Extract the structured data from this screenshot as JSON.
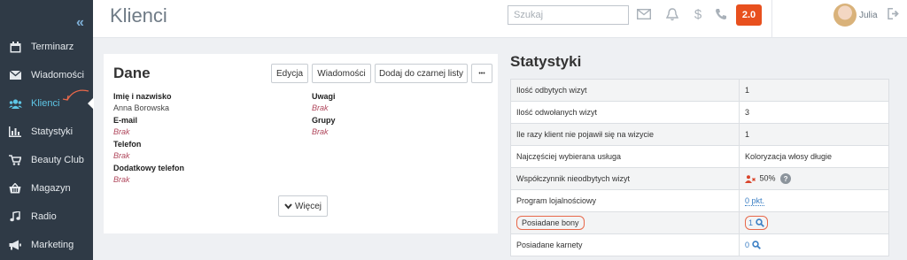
{
  "header": {
    "title": "Klienci",
    "search_placeholder": "Szukaj",
    "version": "2.0",
    "user_name": "Julia"
  },
  "sidebar": {
    "items": [
      {
        "label": "Terminarz",
        "icon": "calendar-icon"
      },
      {
        "label": "Wiadomości",
        "icon": "envelope-icon"
      },
      {
        "label": "Klienci",
        "icon": "users-icon",
        "active": true
      },
      {
        "label": "Statystyki",
        "icon": "bar-chart-icon"
      },
      {
        "label": "Beauty Club",
        "icon": "cart-icon"
      },
      {
        "label": "Magazyn",
        "icon": "basket-icon"
      },
      {
        "label": "Radio",
        "icon": "music-icon"
      },
      {
        "label": "Marketing",
        "icon": "megaphone-icon"
      }
    ]
  },
  "dane": {
    "title": "Dane",
    "buttons": {
      "edit": "Edycja",
      "messages": "Wiadomości",
      "blacklist": "Dodaj do czarnej listy",
      "more_dots": "•••"
    },
    "fields": {
      "name_label": "Imię i nazwisko",
      "name_value": "Anna Borowska",
      "email_label": "E-mail",
      "email_value": "Brak",
      "phone_label": "Telefon",
      "phone_value": "Brak",
      "extra_phone_label": "Dodatkowy telefon",
      "extra_phone_value": "Brak",
      "notes_label": "Uwagi",
      "notes_value": "Brak",
      "groups_label": "Grupy",
      "groups_value": "Brak"
    },
    "more_button": "Więcej"
  },
  "stats": {
    "title": "Statystyki",
    "rows": [
      {
        "label": "Ilość odbytych wizyt",
        "value": "1"
      },
      {
        "label": "Ilość odwołanych wizyt",
        "value": "3"
      },
      {
        "label": "Ile razy klient nie pojawił się na wizycie",
        "value": "1"
      },
      {
        "label": "Najczęściej wybierana usługa",
        "value": "Koloryzacja włosy długie"
      },
      {
        "label": "Współczynnik nieodbytych wizyt",
        "value": "50%"
      },
      {
        "label": "Program lojalnościowy",
        "value": "0 pkt."
      },
      {
        "label": "Posiadane bony",
        "value": "1"
      },
      {
        "label": "Posiadane karnety",
        "value": "0"
      }
    ]
  },
  "colors": {
    "sidebar": "#2f3a46",
    "active": "#5ec6e6",
    "version_badge": "#e8501e",
    "empty_value": "#b0475c",
    "link": "#3b7fc4",
    "highlight": "#e8684a"
  }
}
